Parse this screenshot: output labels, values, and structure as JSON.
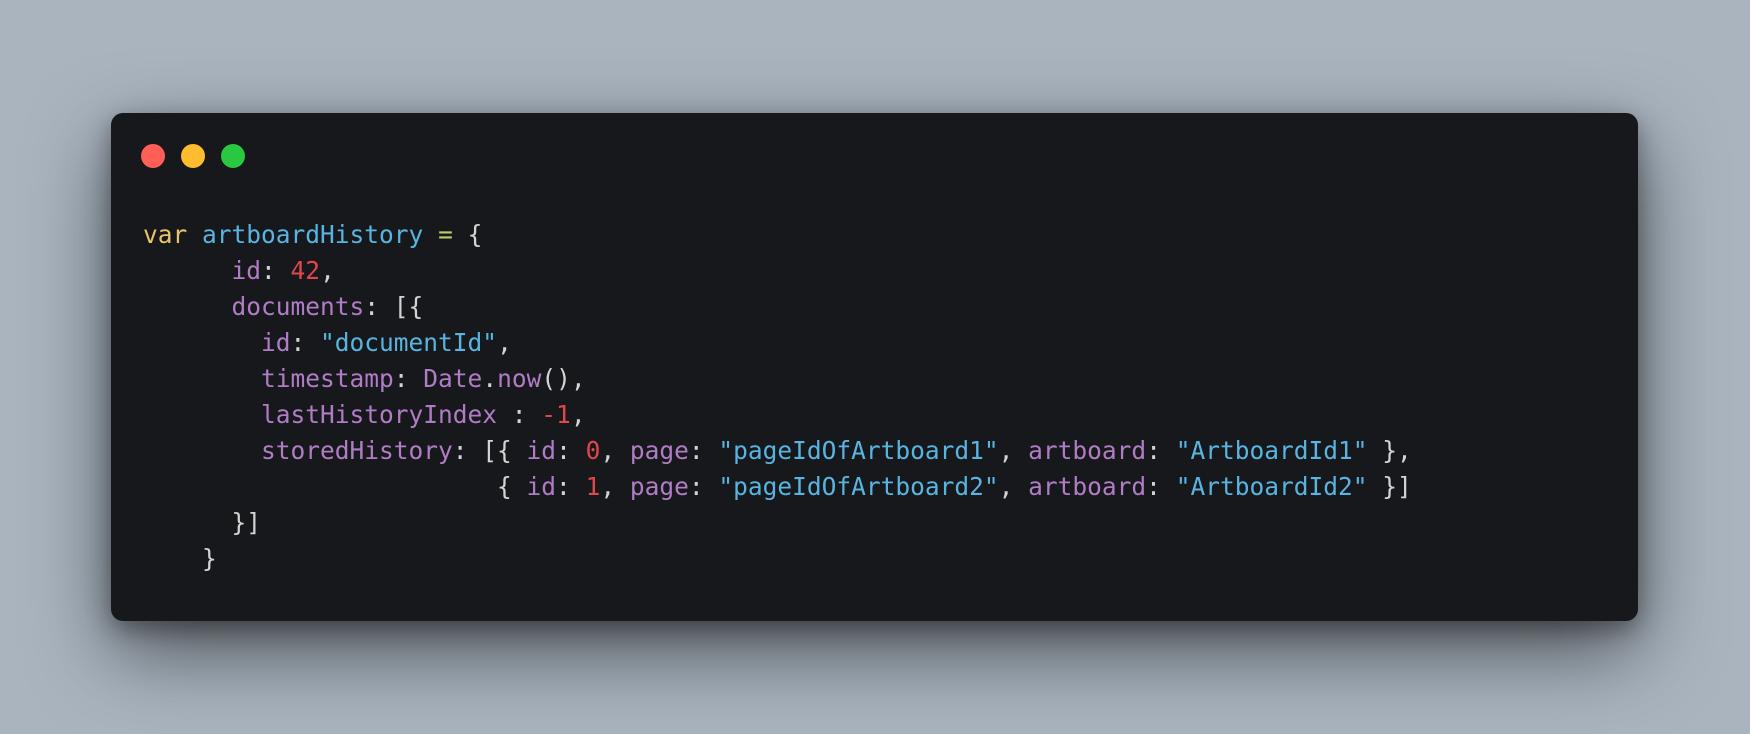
{
  "window": {
    "controls": {
      "close_color": "#ff5f57",
      "minimize_color": "#febc2e",
      "maximize_color": "#28c840"
    }
  },
  "code": {
    "keyword_var": "var",
    "variable_name": "artboardHistory",
    "assign_op": "=",
    "open_brace": "{",
    "id_key": "id",
    "id_value": "42",
    "documents_key": "documents",
    "open_array_obj": "[{",
    "doc_id_key": "id",
    "doc_id_value": "\"documentId\"",
    "timestamp_key": "timestamp",
    "date_obj": "Date",
    "now_fn": "now",
    "parens": "()",
    "last_index_key": "lastHistoryIndex",
    "last_index_value": "-1",
    "stored_history_key": "storedHistory",
    "entries": [
      {
        "id_key": "id",
        "id_value": "0",
        "page_key": "page",
        "page_value": "\"pageIdOfArtboard1\"",
        "artboard_key": "artboard",
        "artboard_value": "\"ArtboardId1\""
      },
      {
        "id_key": "id",
        "id_value": "1",
        "page_key": "page",
        "page_value": "\"pageIdOfArtboard2\"",
        "artboard_key": "artboard",
        "artboard_value": "\"ArtboardId2\""
      }
    ],
    "close_array_obj": "}]",
    "close_brace": "}"
  }
}
